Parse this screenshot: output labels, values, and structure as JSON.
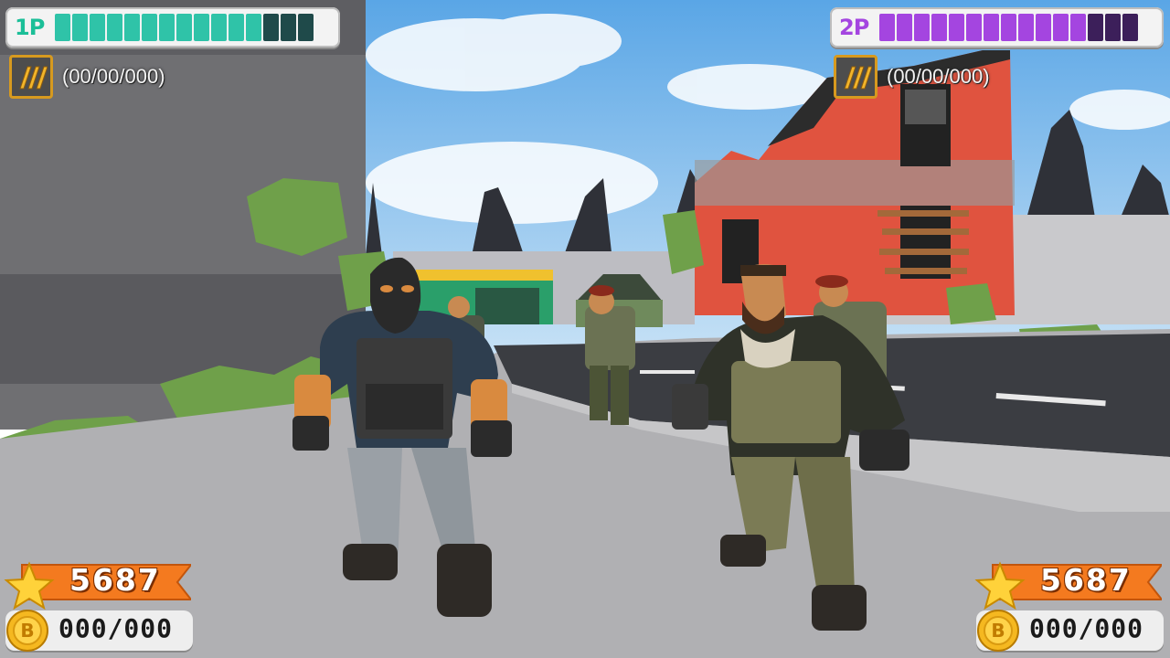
{
  "hud": {
    "p1": {
      "label": "1P",
      "health_filled": 12,
      "health_total": 15,
      "color_filled": "#2fc3a8",
      "color_empty": "#1f4a4a",
      "ammo_text": "(00/00/000)",
      "score": "5687",
      "coins": "000/000"
    },
    "p2": {
      "label": "2P",
      "health_filled": 12,
      "health_total": 15,
      "color_filled": "#a445e0",
      "color_empty": "#3c1f5a",
      "ammo_text": "(00/00/000)",
      "score": "5687",
      "coins": "000/000"
    },
    "icons": {
      "ammo": "bullets-icon",
      "score": "star-icon",
      "coin": "coin-icon"
    },
    "accent": "#f47a1f"
  }
}
